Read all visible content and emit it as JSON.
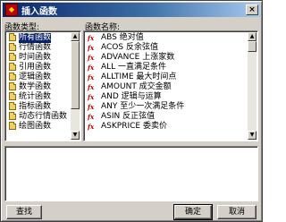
{
  "window": {
    "title": "插入函数",
    "app_icon": "app-logo-icon",
    "close_label": "×"
  },
  "categories": {
    "label": "函数类型:",
    "items": [
      {
        "label": "所有函数"
      },
      {
        "label": "行情函数"
      },
      {
        "label": "时间函数"
      },
      {
        "label": "引用函数"
      },
      {
        "label": "逻辑函数"
      },
      {
        "label": "数学函数"
      },
      {
        "label": "统计函数"
      },
      {
        "label": "指标函数"
      },
      {
        "label": "动态行情函数"
      },
      {
        "label": "绘图函数"
      }
    ],
    "selected_index": 0
  },
  "functions": {
    "label": "函数名称:",
    "items": [
      {
        "label": "ABS 绝对值"
      },
      {
        "label": "ACOS 反余弦值"
      },
      {
        "label": "ADVANCE 上涨家数"
      },
      {
        "label": "ALL 一直满足条件"
      },
      {
        "label": "ALLTIME 最大时间点"
      },
      {
        "label": "AMOUNT 成交金额"
      },
      {
        "label": "AND 逻辑与运算"
      },
      {
        "label": "ANY 至少一次满足条件"
      },
      {
        "label": "ASIN 反正弦值"
      },
      {
        "label": "ASKPRICE 委卖价"
      }
    ]
  },
  "description": {
    "text": ""
  },
  "buttons": {
    "search": "查找",
    "ok": "确定",
    "cancel": "取消"
  },
  "colors": {
    "selection": "#0a246a",
    "fx_icon": "#c00000",
    "face": "#d4d0c8"
  }
}
